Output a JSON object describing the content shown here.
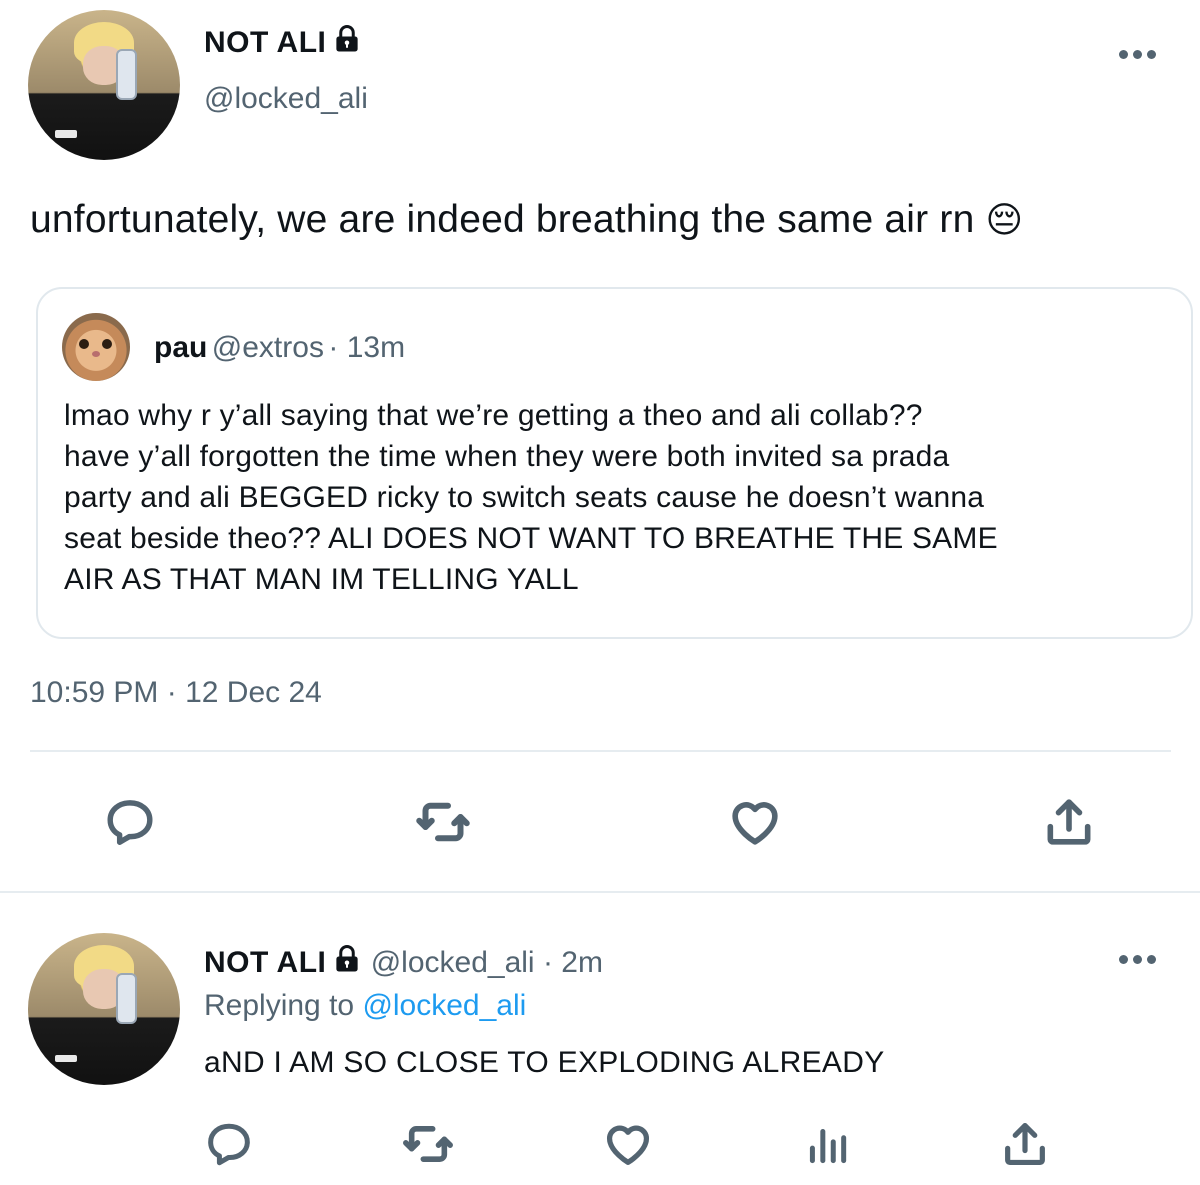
{
  "main_tweet": {
    "display_name": "NOT ALI",
    "handle": "@locked_ali",
    "text": "unfortunately, we are indeed breathing the same air rn",
    "emoji": "😔",
    "quoted": {
      "name": "pau",
      "handle": "@extros",
      "time": "· 13m",
      "lines": [
        "lmao why r y’all saying that we’re getting a theo and ali collab??",
        "have y’all forgotten the time when they were both invited sa prada",
        "party and ali BEGGED ricky to switch seats cause he doesn’t wanna",
        "seat beside theo?? ALI DOES NOT WANT TO BREATHE THE SAME",
        "AIR AS THAT MAN IM TELLING YALL"
      ]
    },
    "timestamp": "10:59 PM · 12 Dec 24",
    "actions": [
      "reply-icon",
      "retweet-icon",
      "like-icon",
      "share-icon"
    ]
  },
  "reply_tweet": {
    "display_name": "NOT ALI",
    "handle": "@locked_ali",
    "time": "· 2m",
    "replying_prefix": "Replying to",
    "replying_to": "@locked_ali",
    "text": "aND I AM SO CLOSE TO EXPLODING ALREADY",
    "actions": [
      "reply-icon",
      "retweet-icon",
      "like-icon",
      "analytics-icon",
      "share-icon"
    ]
  },
  "colors": {
    "text": "#0f1419",
    "secondary": "#536471",
    "link": "#1d9bf0",
    "border": "#e1e8ed"
  }
}
